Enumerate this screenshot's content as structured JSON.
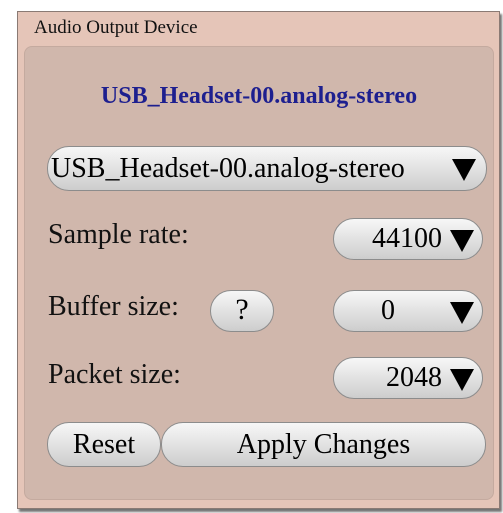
{
  "window": {
    "title": "Audio Output Device"
  },
  "device": {
    "title": "USB_Headset-00.analog-stereo",
    "selected": "USB_Headset-00.analog-stereo"
  },
  "sample_rate": {
    "label": "Sample rate:",
    "value": "44100"
  },
  "buffer_size": {
    "label": "Buffer size:",
    "help_label": "?",
    "value": "0"
  },
  "packet_size": {
    "label": "Packet size:",
    "value": "2048"
  },
  "actions": {
    "reset_label": "Reset",
    "apply_label": "Apply Changes"
  },
  "icons": {
    "dropdown": "triangle-down-icon"
  }
}
